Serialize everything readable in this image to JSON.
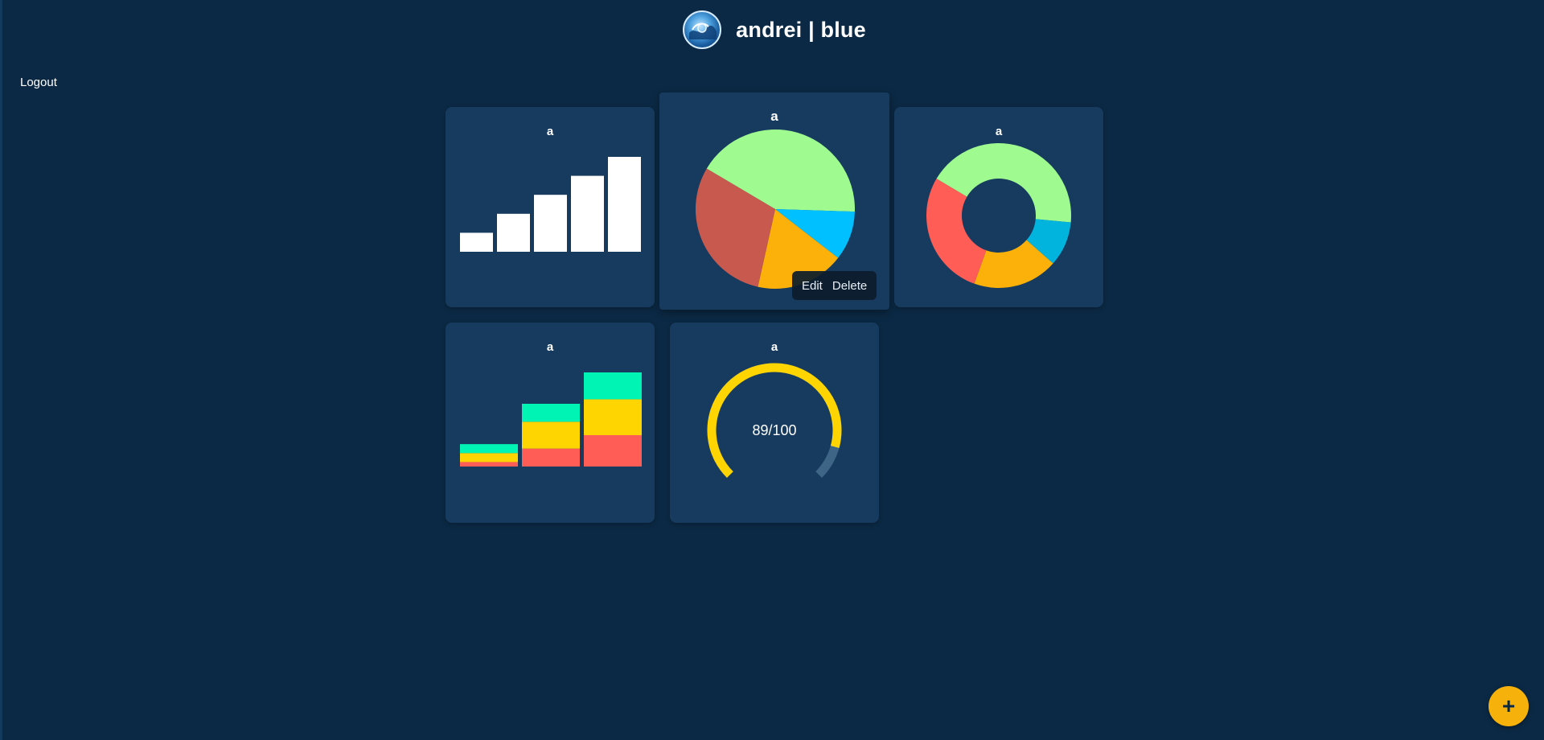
{
  "header": {
    "title": "andrei | blue",
    "logo_icon": "wave-globe-logo"
  },
  "nav": {
    "logout_label": "Logout"
  },
  "cards": [
    {
      "title": "a",
      "chart_type": "bar",
      "color": "#ffffff"
    },
    {
      "title": "a",
      "chart_type": "pie",
      "colors": [
        "#9ffb8f",
        "#00c0ff",
        "#fbb00a",
        "#c8594f"
      ],
      "menu": {
        "edit_label": "Edit",
        "delete_label": "Delete"
      }
    },
    {
      "title": "a",
      "chart_type": "donut",
      "colors": [
        "#9ffb8f",
        "#00b4de",
        "#fbb00a",
        "#ff5d55"
      ]
    },
    {
      "title": "a",
      "chart_type": "stacked-bar",
      "colors": [
        "#00f5b4",
        "#ffd500",
        "#ff5d55"
      ]
    },
    {
      "title": "a",
      "chart_type": "gauge",
      "value_label": "89/100",
      "colors": [
        "#ffd500",
        "#3f6586"
      ]
    }
  ],
  "chart_data": [
    {
      "type": "bar",
      "values": [
        1,
        2,
        3,
        4,
        5
      ]
    },
    {
      "type": "pie",
      "values": [
        42,
        10,
        18,
        30
      ]
    },
    {
      "type": "pie",
      "donut": true,
      "values": [
        43,
        10,
        19,
        28
      ]
    },
    {
      "type": "bar",
      "stacked": true,
      "series": [
        {
          "values": [
            1,
            2,
            3
          ]
        },
        {
          "values": [
            1,
            3,
            4
          ]
        },
        {
          "values": [
            0.5,
            2,
            3.5
          ]
        }
      ]
    },
    {
      "type": "gauge",
      "value": 89,
      "max": 100
    }
  ],
  "fab": {
    "label": "+"
  }
}
